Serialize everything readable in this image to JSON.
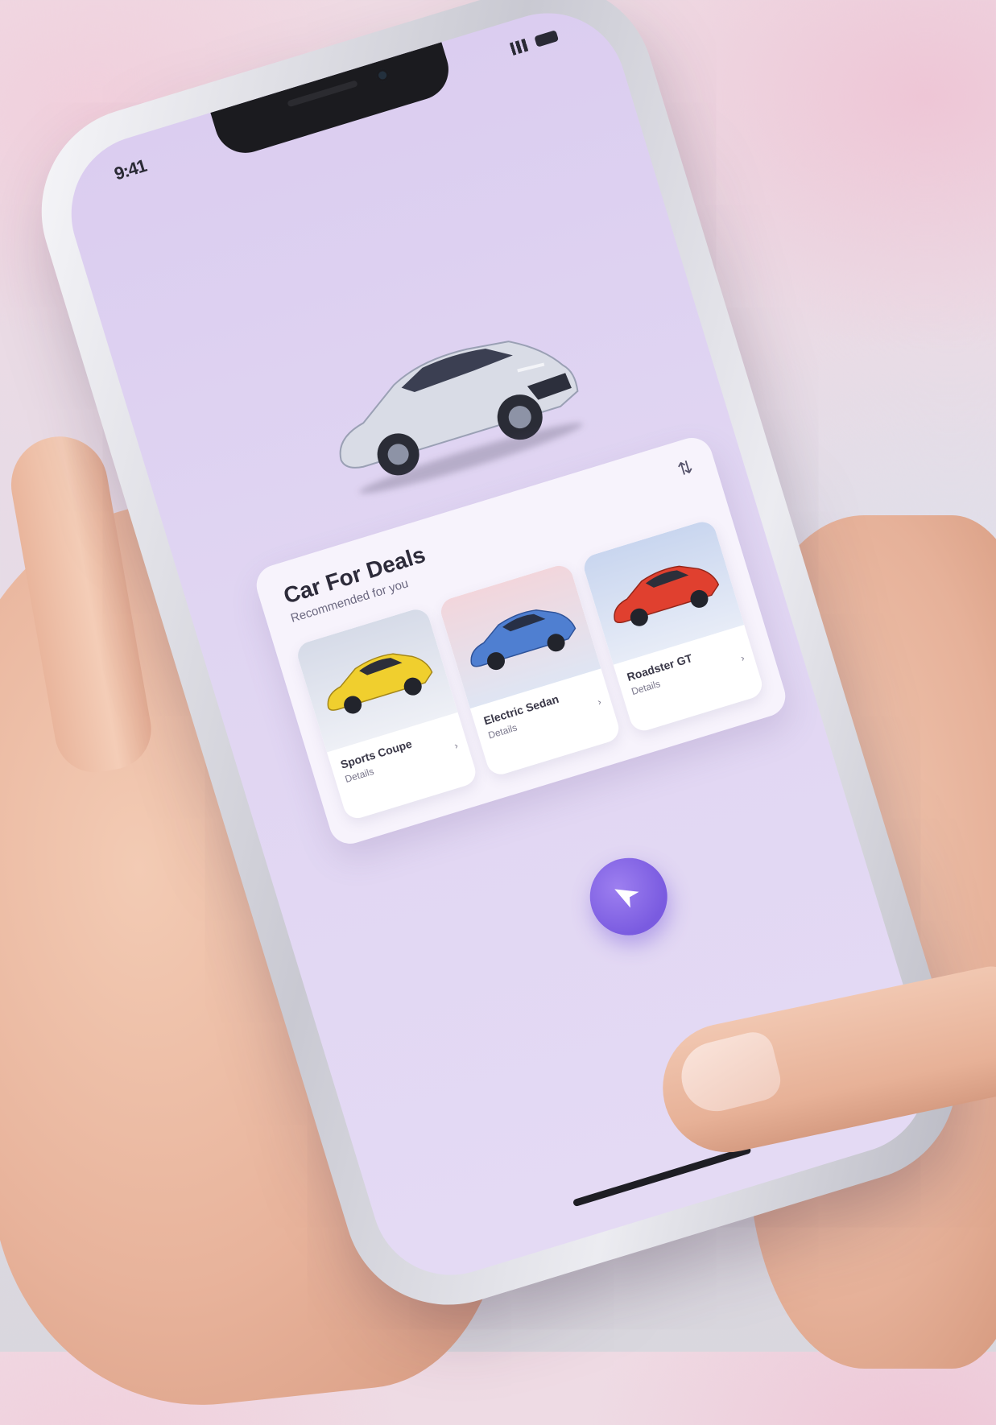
{
  "status_bar": {
    "time": "9:41"
  },
  "card": {
    "title": "Car For Deals",
    "subtitle": "Recommended for you",
    "corner_icon": "filter-icon",
    "cars": [
      {
        "name": "Sports Coupe",
        "meta_left": "Details",
        "meta_right": "›",
        "color": "#f0cf2e"
      },
      {
        "name": "Electric Sedan",
        "meta_left": "Details",
        "meta_right": "›",
        "color": "#4f7fd1"
      },
      {
        "name": "Roadster GT",
        "meta_left": "Details",
        "meta_right": "›",
        "color": "#e0402f"
      }
    ]
  },
  "hero_car": {
    "color": "#d9dce6",
    "icon": "car-icon"
  },
  "fab": {
    "icon": "navigation-arrow-icon",
    "color": "#7a5be0"
  },
  "colors": {
    "screen_bg": "#ddd0f1",
    "accent": "#7a5be0"
  }
}
